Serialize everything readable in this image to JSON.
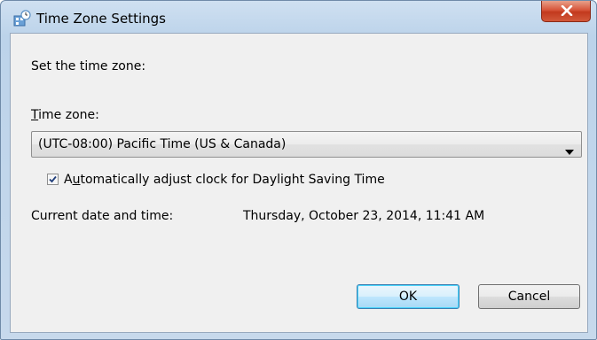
{
  "window": {
    "title": "Time Zone Settings",
    "title_icon": "clock-globe-icon",
    "close_icon": "close-icon"
  },
  "dialog": {
    "instruction": "Set the time zone:",
    "timezone_label_underlined": "T",
    "timezone_label_rest": "ime zone:",
    "timezone_value": "(UTC-08:00) Pacific Time (US & Canada)",
    "dst_checked": true,
    "dst_label_before": "A",
    "dst_label_underlined": "u",
    "dst_label_after": "tomatically adjust clock for Daylight Saving Time",
    "current_label": "Current date and time:",
    "current_value": "Thursday, October 23, 2014, 11:41 AM"
  },
  "buttons": {
    "ok": "OK",
    "cancel": "Cancel"
  },
  "colors": {
    "client_bg": "#f0f0f0",
    "frame": "#bcd3ea",
    "close_red": "#c23a1e",
    "default_button_border": "#3c7fb1"
  }
}
